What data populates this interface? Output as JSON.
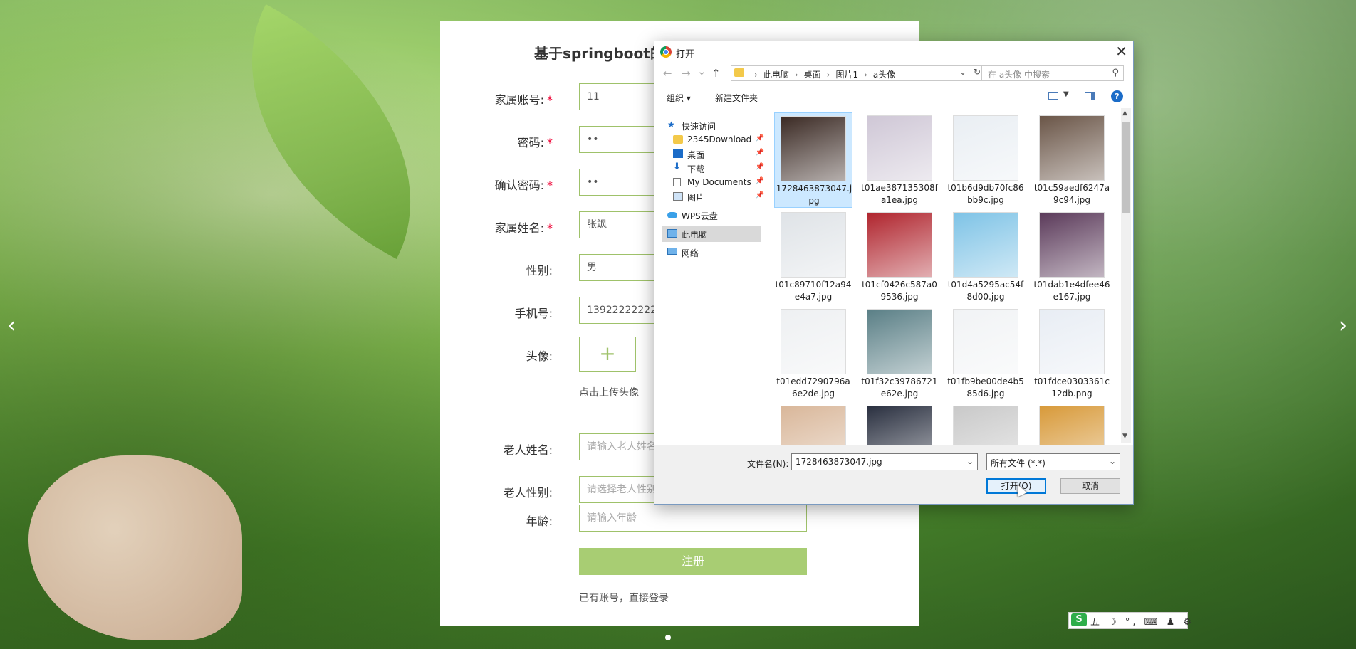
{
  "register": {
    "title": "基于springboot的",
    "fields": [
      {
        "label": "家属账号:",
        "value": "11",
        "required": true
      },
      {
        "label": "密码:",
        "value": "••",
        "required": true
      },
      {
        "label": "确认密码:",
        "value": "••",
        "required": true
      },
      {
        "label": "家属姓名:",
        "value": "张飒",
        "required": true
      },
      {
        "label": "性别:",
        "value": "男",
        "required": false
      },
      {
        "label": "手机号:",
        "value": "13922222222",
        "required": false
      },
      {
        "label": "头像:",
        "value": "+",
        "required": false
      },
      {
        "label": "老人姓名:",
        "placeholder": "请输入老人姓名",
        "required": false
      },
      {
        "label": "老人性别:",
        "placeholder": "请选择老人性别",
        "required": false
      },
      {
        "label": "年龄:",
        "placeholder": "请输入年龄",
        "required": false
      }
    ],
    "required_mark": "*",
    "avatar_hint": "点击上传头像",
    "submit_label": "注册",
    "login_link": "已有账号，直接登录"
  },
  "carousel": {
    "prev": "‹",
    "next": "›"
  },
  "dialog": {
    "title": "打开",
    "close": "✕",
    "nav": {
      "back": "←",
      "forward": "→",
      "recent": "⌄",
      "up": "↑"
    },
    "breadcrumbs": [
      "此电脑",
      "桌面",
      "图片1",
      "a头像"
    ],
    "breadcrumb_sep": "›",
    "search_placeholder": "在 a头像 中搜索",
    "toolbar": {
      "organize": "组织 ▾",
      "new_folder": "新建文件夹",
      "help": "?"
    },
    "nav_pane": [
      {
        "label": "快速访问",
        "icon": "star-icon",
        "pinned": false
      },
      {
        "label": "2345Download",
        "icon": "folder-icon",
        "pinned": true
      },
      {
        "label": "桌面",
        "icon": "desktop-icon",
        "pinned": true
      },
      {
        "label": "下载",
        "icon": "download-icon",
        "pinned": true
      },
      {
        "label": "My Documents",
        "icon": "document-icon",
        "pinned": true
      },
      {
        "label": "图片",
        "icon": "pictures-icon",
        "pinned": true
      },
      {
        "label": "WPS云盘",
        "icon": "cloud-icon",
        "pinned": false
      },
      {
        "label": "此电脑",
        "icon": "computer-icon",
        "pinned": false,
        "selected": true
      },
      {
        "label": "网络",
        "icon": "network-icon",
        "pinned": false
      }
    ],
    "pin_glyph": "📌",
    "files": [
      {
        "name": "1728463873047.jpg",
        "color": "#3b2a24",
        "selected": true
      },
      {
        "name": "t01ae387135308fa1ea.jpg",
        "color": "#cfc7d6"
      },
      {
        "name": "t01b6d9db70fc86bb9c.jpg",
        "color": "#e9eef3"
      },
      {
        "name": "t01c59aedf6247a9c94.jpg",
        "color": "#6a5547"
      },
      {
        "name": "t01c89710f12a94e4a7.jpg",
        "color": "#dfe3e7"
      },
      {
        "name": "t01cf0426c587a09536.jpg",
        "color": "#b0252e"
      },
      {
        "name": "t01d4a5295ac54f8d00.jpg",
        "color": "#7ec3e6"
      },
      {
        "name": "t01dab1e4dfee46e167.jpg",
        "color": "#5b3a5a"
      },
      {
        "name": "t01edd7290796a6e2de.jpg",
        "color": "#eef0f2"
      },
      {
        "name": "t01f32c39786721e62e.jpg",
        "color": "#5a7f86"
      },
      {
        "name": "t01fb9be00de4b585d6.jpg",
        "color": "#f1f3f5"
      },
      {
        "name": "t01fdce0303361c12db.png",
        "color": "#e8edf4"
      },
      {
        "name": "",
        "color": "#d9b79a"
      },
      {
        "name": "",
        "color": "#2a3040"
      },
      {
        "name": "",
        "color": "#c9c9c9"
      },
      {
        "name": "",
        "color": "#d89a3a"
      }
    ],
    "filename_label": "文件名(N):",
    "filename_value": "1728463873047.jpg",
    "filetype_value": "所有文件 (*.*)",
    "open_label": "打开(O)",
    "cancel_label": "取消",
    "dropdown_glyph": "⌄"
  },
  "ime": {
    "logo": "S",
    "items": "五 ☽ °, ⌨ ♟ ⚙"
  }
}
